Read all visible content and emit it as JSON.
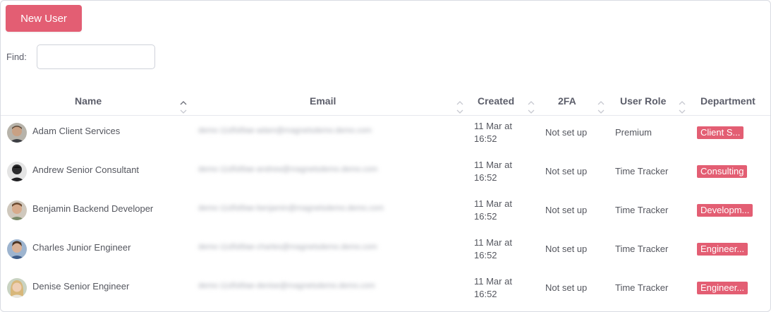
{
  "toolbar": {
    "new_user_label": "New User"
  },
  "search": {
    "label": "Find:",
    "value": "",
    "placeholder": ""
  },
  "table": {
    "columns": {
      "name": "Name",
      "email": "Email",
      "created": "Created",
      "tfa": "2FA",
      "role": "User Role",
      "department": "Department"
    },
    "rows": [
      {
        "name": "Adam Client Services",
        "email": "demo-11d5d9ae-adam@magnetsdemo.demo.com",
        "created_line1": "11 Mar at",
        "created_line2": "16:52",
        "tfa": "Not set up",
        "role": "Premium",
        "department": "Client S..."
      },
      {
        "name": "Andrew Senior Consultant",
        "email": "demo-11d5d9ae-andrew@magnetsdemo.demo.com",
        "created_line1": "11 Mar at",
        "created_line2": "16:52",
        "tfa": "Not set up",
        "role": "Time Tracker",
        "department": "Consulting"
      },
      {
        "name": "Benjamin Backend Developer",
        "email": "demo-11d5d9ae-benjamin@magnetsdemo.demo.com",
        "created_line1": "11 Mar at",
        "created_line2": "16:52",
        "tfa": "Not set up",
        "role": "Time Tracker",
        "department": "Developm..."
      },
      {
        "name": "Charles Junior Engineer",
        "email": "demo-11d5d9ae-charles@magnetsdemo.demo.com",
        "created_line1": "11 Mar at",
        "created_line2": "16:52",
        "tfa": "Not set up",
        "role": "Time Tracker",
        "department": "Engineer..."
      },
      {
        "name": "Denise Senior Engineer",
        "email": "demo-11d5d9ae-denise@magnetsdemo.demo.com",
        "created_line1": "11 Mar at",
        "created_line2": "16:52",
        "tfa": "Not set up",
        "role": "Time Tracker",
        "department": "Engineer..."
      }
    ]
  },
  "colors": {
    "accent": "#e35e73",
    "text": "#55575f",
    "border": "#d9dbe2"
  }
}
